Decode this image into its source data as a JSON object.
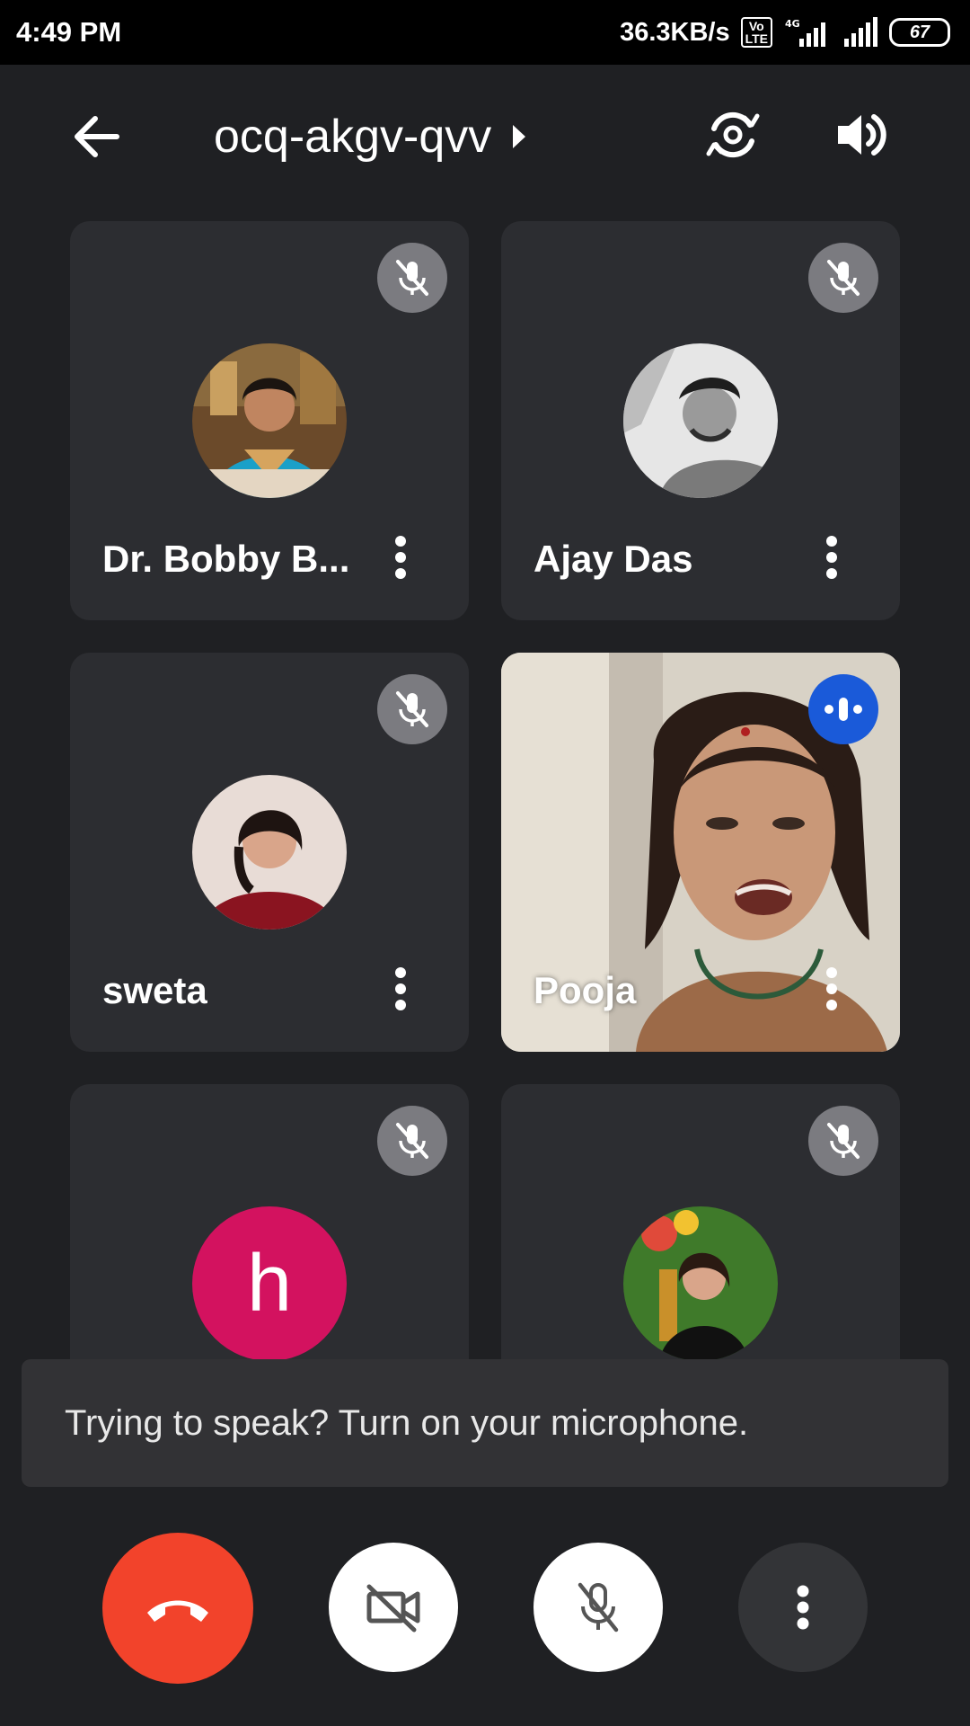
{
  "status_bar": {
    "time": "4:49 PM",
    "net_speed": "36.3KB/s",
    "volte_label": "Vo\nLTE",
    "network_type": "4G",
    "battery": "67"
  },
  "header": {
    "meeting_code": "ocq-akgv-qvv",
    "icons": [
      "arrow-back-icon",
      "play-arrow-icon",
      "switch-camera-icon",
      "speaker-icon"
    ]
  },
  "participants": [
    {
      "name": "Dr. Bobby B...",
      "muted": true,
      "avatar": "photo"
    },
    {
      "name": "Ajay Das",
      "muted": true,
      "avatar": "photo"
    },
    {
      "name": "sweta",
      "muted": true,
      "avatar": "photo"
    },
    {
      "name": "Pooja",
      "muted": false,
      "speaking": true,
      "avatar": "video"
    },
    {
      "name": "",
      "muted": true,
      "avatar": "letter",
      "avatar_letter": "h",
      "avatar_color": "#d3125f"
    },
    {
      "name": "",
      "muted": true,
      "avatar": "photo"
    }
  ],
  "snackbar": {
    "message": "Trying to speak? Turn on your microphone."
  },
  "controls": {
    "icons": [
      "call-end-icon",
      "videocam-off-icon",
      "mic-off-icon",
      "more-vert-icon"
    ],
    "end_call_color": "#f2432b"
  }
}
